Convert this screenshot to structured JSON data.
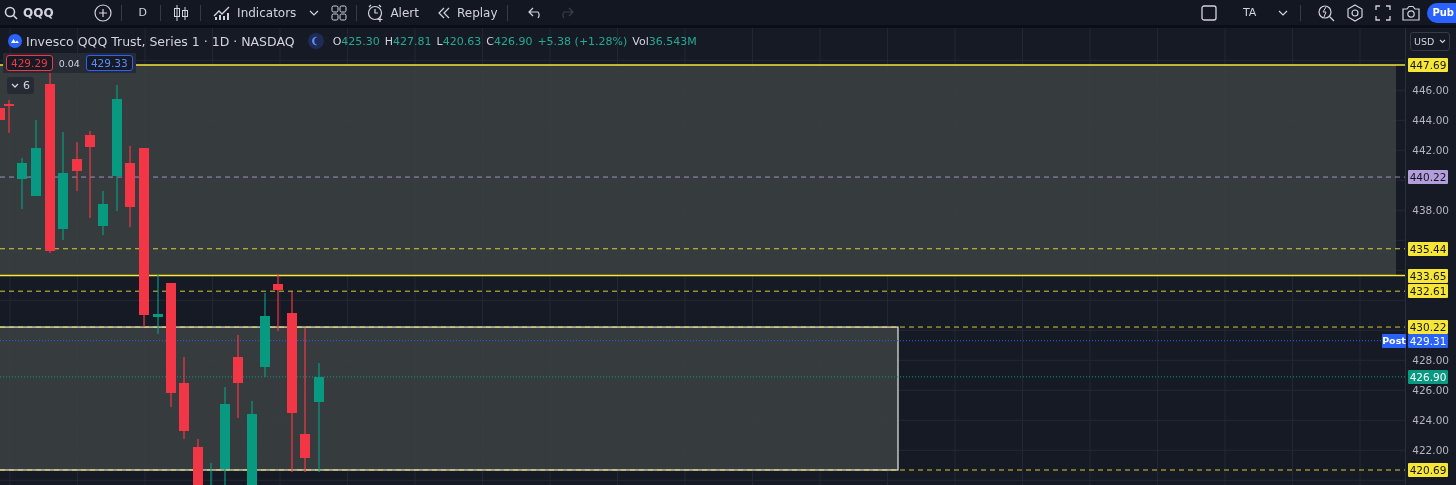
{
  "toolbar": {
    "symbol": "QQQ",
    "interval": "D",
    "indicators": "Indicators",
    "alert": "Alert",
    "replay": "Replay",
    "redo": {
      "disabled": true
    },
    "layout_name": "TA",
    "publish": "Pub"
  },
  "legend": {
    "title": "Invesco QQQ Trust, Series 1 · 1D · NASDAQ",
    "ohlc": [
      {
        "label": "O",
        "value": "425.30"
      },
      {
        "label": "H",
        "value": "427.81"
      },
      {
        "label": "L",
        "value": "420.63"
      },
      {
        "label": "C",
        "value": "426.90"
      }
    ],
    "change": "+5.38 (+1.28%)",
    "volume": {
      "label": "Vol",
      "value": "36.543M"
    }
  },
  "quote": {
    "bid": "429.29",
    "spread": "0.04",
    "ask": "429.33"
  },
  "indicators_collapsed": {
    "count": "6",
    "expanded": false
  },
  "price_axis": {
    "currency": "USD",
    "ticks": [
      "446.00",
      "444.00",
      "442.00",
      "438.00",
      "428.00",
      "426.00",
      "424.00",
      "422.00"
    ],
    "tags": [
      {
        "kind": "solid",
        "text": "447.69",
        "color": "#f7e636"
      },
      {
        "kind": "dashed",
        "text": "440.22",
        "color": "#b39ddb"
      },
      {
        "kind": "dashed",
        "text": "435.44",
        "color": "#f7e636"
      },
      {
        "kind": "solid",
        "text": "433.65",
        "color": "#f7e636"
      },
      {
        "kind": "dashed",
        "text": "432.61",
        "color": "#f7e636"
      },
      {
        "kind": "dashed",
        "text": "430.22",
        "color": "#f7e636"
      },
      {
        "kind": "dotted",
        "label": "Post",
        "text": "429.31",
        "color": "#2962ff"
      },
      {
        "kind": "dotted",
        "text": "426.90",
        "color": "#089981"
      },
      {
        "kind": "dashed",
        "text": "420.69",
        "color": "#f7e636"
      }
    ]
  }
}
